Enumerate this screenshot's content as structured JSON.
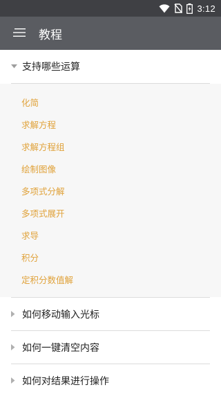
{
  "status_bar": {
    "time": "3:12",
    "icons": [
      "wifi-icon",
      "no-sim-icon",
      "battery-charging-icon"
    ]
  },
  "app_bar": {
    "menu_icon": "menu-icon",
    "title": "教程"
  },
  "sections": [
    {
      "title": "支持哪些运算",
      "expanded": true,
      "items": [
        {
          "label": "化简"
        },
        {
          "label": "求解方程"
        },
        {
          "label": "求解方程组"
        },
        {
          "label": "绘制图像"
        },
        {
          "label": "多项式分解"
        },
        {
          "label": "多项式展开"
        },
        {
          "label": "求导"
        },
        {
          "label": "积分"
        },
        {
          "label": "定积分数值解"
        }
      ]
    },
    {
      "title": "如何移动输入光标",
      "expanded": false
    },
    {
      "title": "如何一键清空内容",
      "expanded": false
    },
    {
      "title": "如何对结果进行操作",
      "expanded": false
    }
  ],
  "colors": {
    "status_bar": "#3f4044",
    "app_bar": "#5a5c61",
    "link": "#e0a23a",
    "expanded_bg": "#f7f7f7",
    "divider": "#dcdcdc"
  }
}
